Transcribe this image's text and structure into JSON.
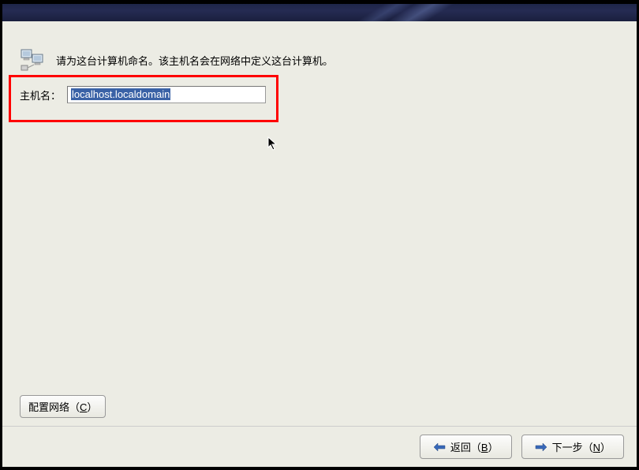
{
  "instruction": "请为这台计算机命名。该主机名会在网络中定义这台计算机。",
  "hostname": {
    "label": "主机名：",
    "value": "localhost.localdomain"
  },
  "buttons": {
    "configure_network": "配置网络（",
    "configure_network_key": "C",
    "configure_network_end": "）",
    "back_prefix": "返回（",
    "back_key": "B",
    "back_suffix": "）",
    "next_prefix": "下一步（",
    "next_key": "N",
    "next_suffix": "）"
  }
}
